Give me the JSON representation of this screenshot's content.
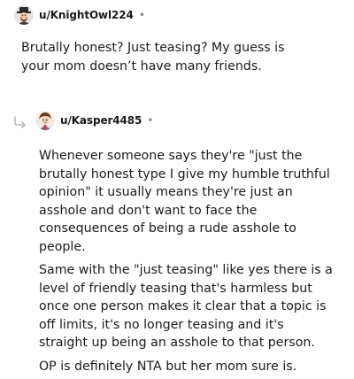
{
  "comments": [
    {
      "username": "u/KnightOwl224",
      "separator": "•",
      "avatar_icon": "knight-avatar-icon",
      "paragraphs": [
        "Brutally honest? Just teasing? My guess is your mom doesn’t have many friends."
      ]
    },
    {
      "username": "u/Kasper4485",
      "separator": "•",
      "avatar_icon": "kasper-avatar-icon",
      "reply_icon": "reply-arrow-icon",
      "paragraphs": [
        "Whenever someone says they're \"just the brutally honest type I give my humble truthful opinion\" it usually means they're just an asshole and don't want to face the consequences of being a rude asshole to people.",
        "Same with the \"just teasing\" like yes there is a level of friendly teasing that's harmless but once one person makes it clear that a topic is off limits, it's no longer teasing and it's straight up being an asshole to that person.",
        "OP is definitely NTA but her mom sure is."
      ]
    }
  ],
  "colors": {
    "text": "#1a1a1b",
    "meta": "#878a8c",
    "background": "#ffffff"
  }
}
